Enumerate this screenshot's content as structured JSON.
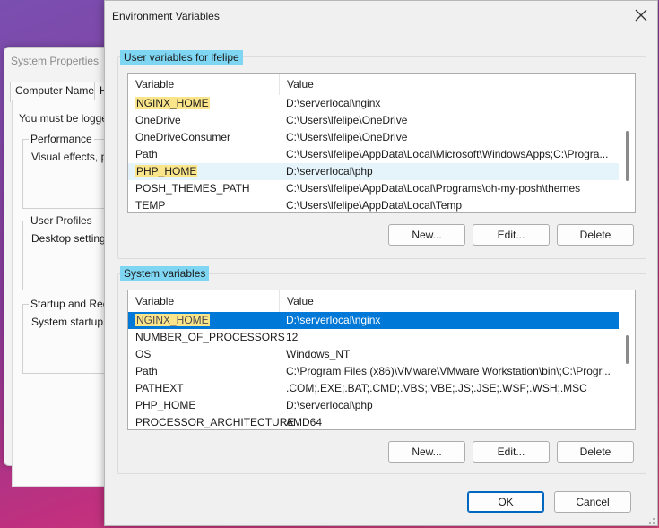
{
  "background_window": {
    "title": "System Properties",
    "tabs": [
      "Computer Name",
      "Ha"
    ],
    "note": "You must be logge",
    "groups": [
      {
        "title": "Performance",
        "desc": "Visual effects, pro"
      },
      {
        "title": "User Profiles",
        "desc": "Desktop settings r"
      },
      {
        "title": "Startup and Reco",
        "desc": "System startup, sy"
      }
    ]
  },
  "dialog": {
    "title": "Environment Variables",
    "close_icon": "close-icon"
  },
  "user_vars": {
    "label": "User variables for lfelipe",
    "columns": [
      "Variable",
      "Value"
    ],
    "rows": [
      {
        "name": "NGINX_HOME",
        "value": "D:\\serverlocal\\nginx"
      },
      {
        "name": "OneDrive",
        "value": "C:\\Users\\lfelipe\\OneDrive"
      },
      {
        "name": "OneDriveConsumer",
        "value": "C:\\Users\\lfelipe\\OneDrive"
      },
      {
        "name": "Path",
        "value": "C:\\Users\\lfelipe\\AppData\\Local\\Microsoft\\WindowsApps;C:\\Progra..."
      },
      {
        "name": "PHP_HOME",
        "value": "D:\\serverlocal\\php"
      },
      {
        "name": "POSH_THEMES_PATH",
        "value": "C:\\Users\\lfelipe\\AppData\\Local\\Programs\\oh-my-posh\\themes"
      },
      {
        "name": "TEMP",
        "value": "C:\\Users\\lfelipe\\AppData\\Local\\Temp"
      }
    ],
    "buttons": {
      "new": "New...",
      "edit": "Edit...",
      "delete": "Delete"
    }
  },
  "system_vars": {
    "label": "System variables",
    "columns": [
      "Variable",
      "Value"
    ],
    "rows": [
      {
        "name": "NGINX_HOME",
        "value": "D:\\serverlocal\\nginx"
      },
      {
        "name": "NUMBER_OF_PROCESSORS",
        "value": "12"
      },
      {
        "name": "OS",
        "value": "Windows_NT"
      },
      {
        "name": "Path",
        "value": "C:\\Program Files (x86)\\VMware\\VMware Workstation\\bin\\;C:\\Progr..."
      },
      {
        "name": "PATHEXT",
        "value": ".COM;.EXE;.BAT;.CMD;.VBS;.VBE;.JS;.JSE;.WSF;.WSH;.MSC"
      },
      {
        "name": "PHP_HOME",
        "value": "D:\\serverlocal\\php"
      },
      {
        "name": "PROCESSOR_ARCHITECTURE",
        "value": "AMD64"
      }
    ],
    "buttons": {
      "new": "New...",
      "edit": "Edit...",
      "delete": "Delete"
    }
  },
  "footer": {
    "ok": "OK",
    "cancel": "Cancel"
  },
  "colors": {
    "selection": "#0078d7",
    "label_highlight": "#7fd6f3",
    "name_highlight": "#fbe58a"
  }
}
